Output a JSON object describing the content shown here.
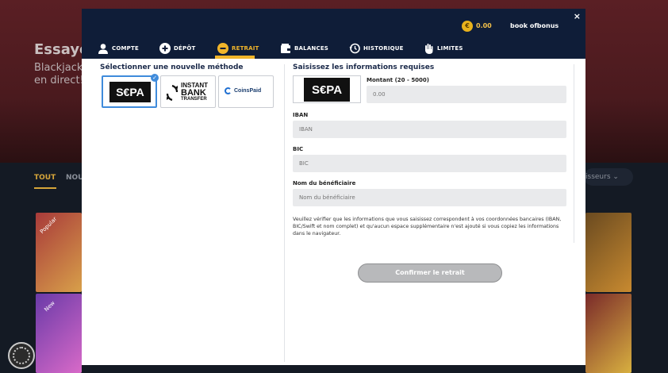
{
  "background": {
    "hero_title": "Essaye",
    "hero_subtitle": "Blackjack en direct!",
    "tabs": [
      {
        "label": "TOUT"
      },
      {
        "label": "NOU"
      }
    ],
    "providers_button": "isseurs",
    "tile_badges": [
      "Popular",
      "New"
    ]
  },
  "header": {
    "close_label": "×",
    "currency_symbol": "€",
    "balance": "0.00",
    "bonus_label": "book ofbonus",
    "nav": [
      {
        "label": "COMPTE",
        "icon": "user-icon"
      },
      {
        "label": "DÉPÔT",
        "icon": "plus-circle-icon"
      },
      {
        "label": "RETRAIT",
        "icon": "minus-circle-icon",
        "active": true
      },
      {
        "label": "BALANCES",
        "icon": "wallet-icon"
      },
      {
        "label": "HISTORIQUE",
        "icon": "history-icon"
      },
      {
        "label": "LIMITES",
        "icon": "hand-icon"
      }
    ]
  },
  "methods": {
    "title": "Sélectionner une nouvelle méthode",
    "items": [
      {
        "label": "S€PA",
        "selected": true
      },
      {
        "label": "INSTANT BANK TRANSFER",
        "lines": [
          "INSTANT",
          "BANK",
          "TRANSFER"
        ]
      },
      {
        "label": "CoinsPaid"
      }
    ]
  },
  "form": {
    "title": "Saisissez les informations requises",
    "selected_method_label": "S€PA",
    "amount": {
      "label": "Montant (20 - 5000)",
      "placeholder": "0.00"
    },
    "iban": {
      "label": "IBAN",
      "placeholder": "IBAN"
    },
    "bic": {
      "label": "BIC",
      "placeholder": "BIC"
    },
    "beneficiary": {
      "label": "Nom du bénéficiaire",
      "placeholder": "Nom du bénéficiaire"
    },
    "notice": "Veuillez vérifier que les informations que vous saisissez correspondent à vos coordonnées bancaires (IBAN, BIC/Swift et nom complet) et qu'aucun espace supplémentaire n'est ajouté si vous copiez les informations dans le navigateur.",
    "confirm_label": "Confirmer le retrait"
  },
  "colors": {
    "header_bg": "#0f1d38",
    "accent": "#f1b52a",
    "selected_border": "#3f8bdb"
  }
}
